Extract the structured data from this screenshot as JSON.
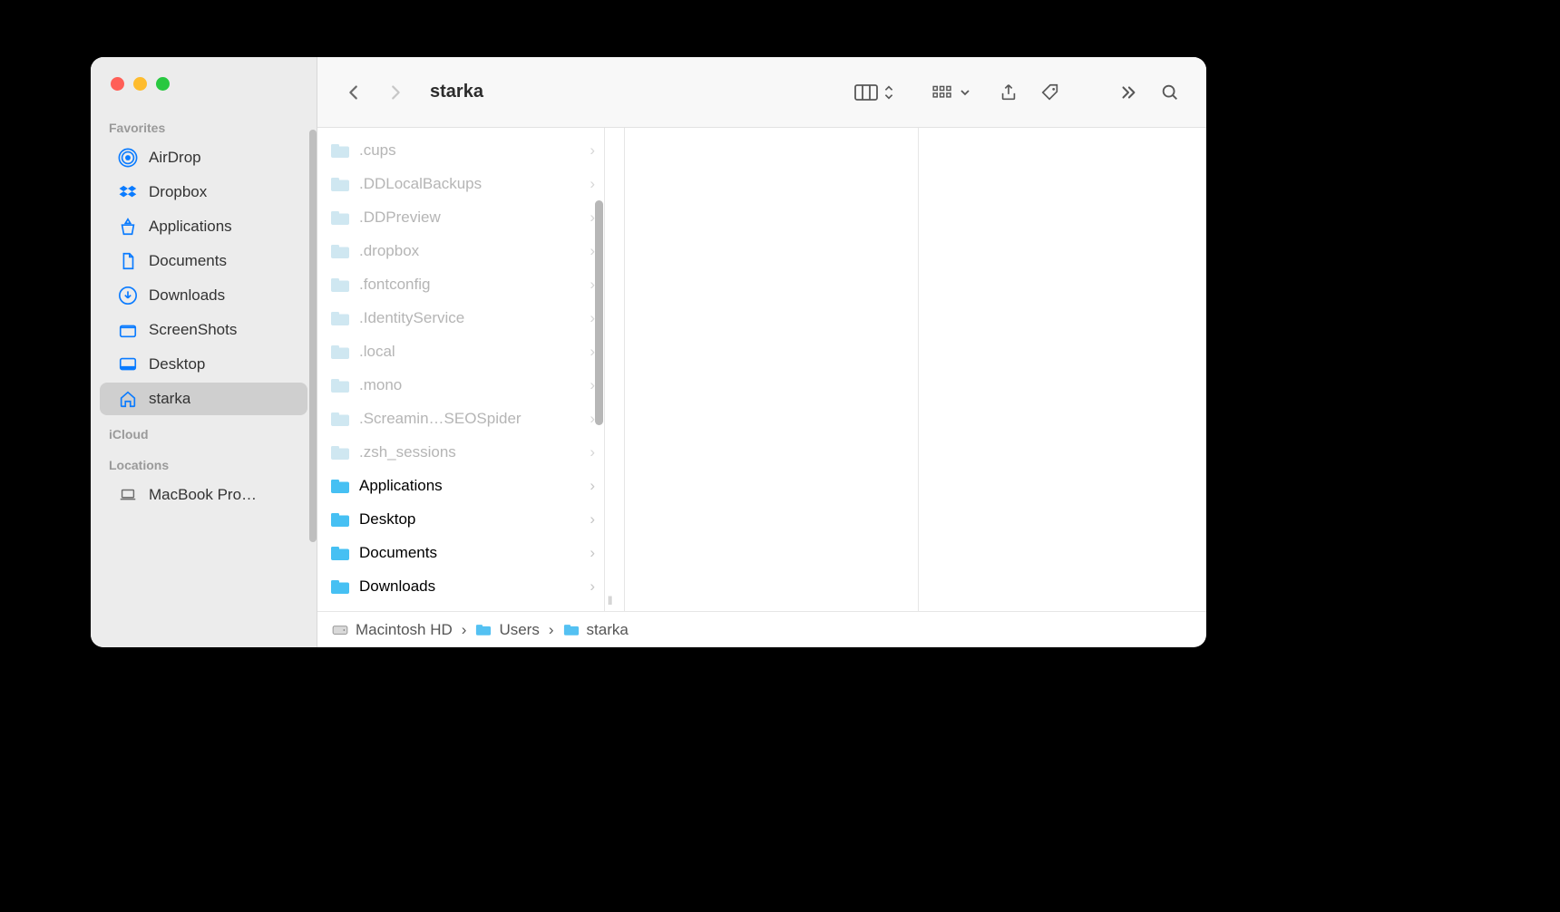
{
  "window_title": "starka",
  "sidebar": {
    "sections": {
      "favorites": "Favorites",
      "icloud": "iCloud",
      "locations": "Locations"
    },
    "favorites": [
      {
        "icon": "airdrop",
        "label": "AirDrop",
        "selected": false
      },
      {
        "icon": "dropbox",
        "label": "Dropbox",
        "selected": false
      },
      {
        "icon": "applications",
        "label": "Applications",
        "selected": false
      },
      {
        "icon": "documents",
        "label": "Documents",
        "selected": false
      },
      {
        "icon": "downloads",
        "label": "Downloads",
        "selected": false
      },
      {
        "icon": "screenshots",
        "label": "ScreenShots",
        "selected": false
      },
      {
        "icon": "desktop",
        "label": "Desktop",
        "selected": false
      },
      {
        "icon": "home",
        "label": "starka",
        "selected": true
      }
    ],
    "locations": [
      {
        "icon": "laptop",
        "label": "MacBook Pro…",
        "selected": false
      }
    ]
  },
  "column_items": [
    {
      "name": ".cups",
      "hidden": true
    },
    {
      "name": ".DDLocalBackups",
      "hidden": true
    },
    {
      "name": ".DDPreview",
      "hidden": true
    },
    {
      "name": ".dropbox",
      "hidden": true
    },
    {
      "name": ".fontconfig",
      "hidden": true
    },
    {
      "name": ".IdentityService",
      "hidden": true
    },
    {
      "name": ".local",
      "hidden": true
    },
    {
      "name": ".mono",
      "hidden": true
    },
    {
      "name": ".Screamin…SEOSpider",
      "hidden": true
    },
    {
      "name": ".zsh_sessions",
      "hidden": true
    },
    {
      "name": "Applications",
      "hidden": false
    },
    {
      "name": "Desktop",
      "hidden": false
    },
    {
      "name": "Documents",
      "hidden": false
    },
    {
      "name": "Downloads",
      "hidden": false
    }
  ],
  "pathbar": [
    {
      "icon": "hd",
      "label": "Macintosh HD"
    },
    {
      "icon": "folder",
      "label": "Users"
    },
    {
      "icon": "home-folder",
      "label": "starka"
    }
  ]
}
